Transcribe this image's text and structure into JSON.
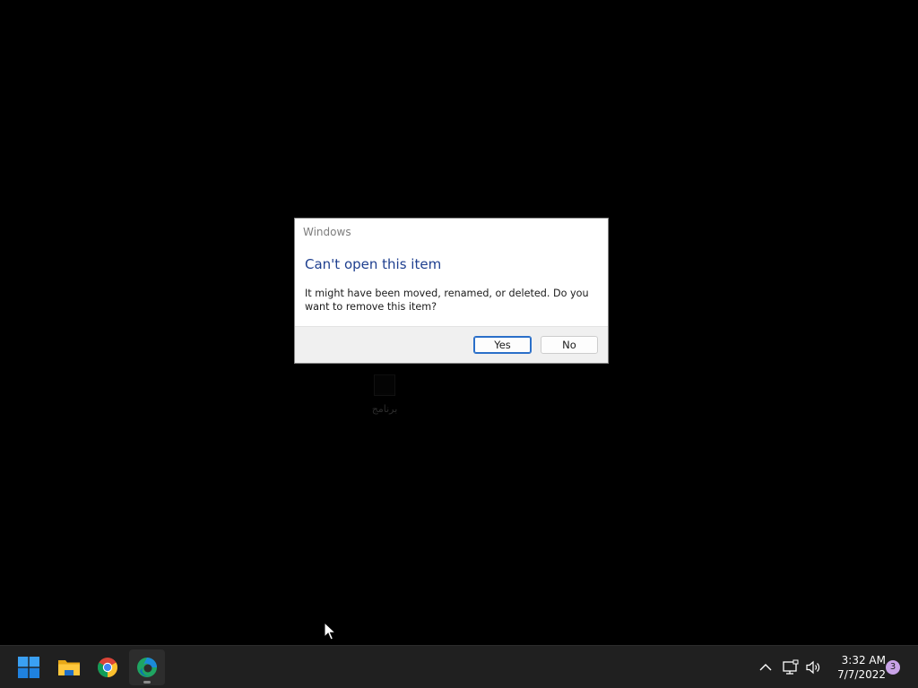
{
  "desktop": {
    "shortcut": {
      "icon": "app-shortcut-icon",
      "label": "برنامج"
    }
  },
  "dialog": {
    "title": "Windows",
    "heading": "Can't open this item",
    "message": "It might have been moved, renamed, or deleted. Do you want to remove this item?",
    "buttons": {
      "yes": "Yes",
      "no": "No"
    },
    "default_button": "yes",
    "colors": {
      "heading": "#1e3f8f",
      "default_button_border": "#2a6fc9"
    }
  },
  "taskbar": {
    "apps": [
      {
        "name": "start",
        "icon": "windows-logo-icon"
      },
      {
        "name": "file-explorer",
        "icon": "folder-icon"
      },
      {
        "name": "google-chrome",
        "icon": "chrome-icon"
      },
      {
        "name": "microsoft-edge",
        "icon": "edge-icon",
        "active": true
      }
    ],
    "tray": {
      "icons": [
        "chevron-up-icon",
        "network-icon",
        "volume-icon"
      ],
      "time": "3:32 AM",
      "date": "7/7/2022",
      "notification_count": "3"
    },
    "colors": {
      "background": "#202020",
      "badge": "#c9a3e8"
    }
  }
}
